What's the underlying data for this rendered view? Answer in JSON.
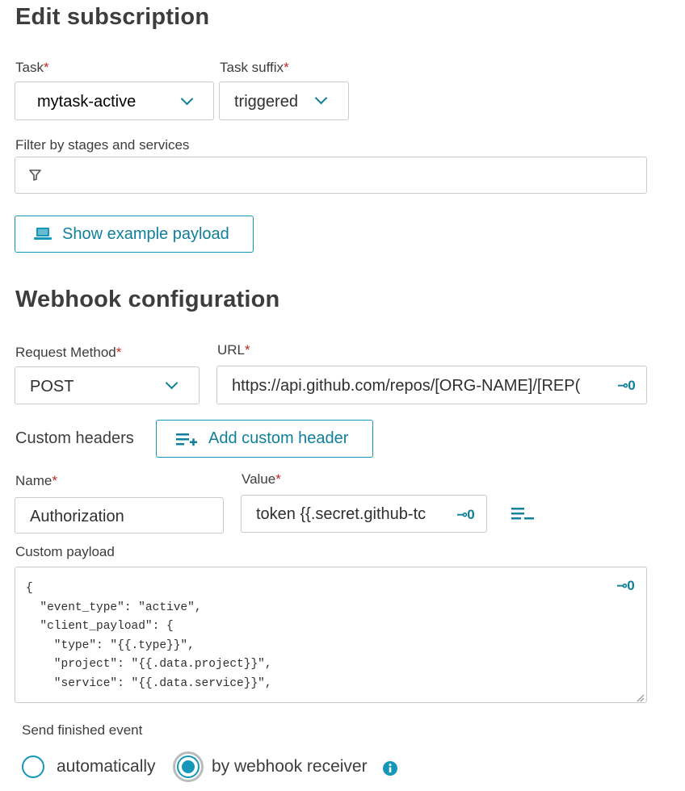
{
  "subscription": {
    "heading": "Edit subscription",
    "task_label": "Task",
    "task_value": "mytask-active",
    "suffix_label": "Task suffix",
    "suffix_value": "triggered",
    "filter_label": "Filter by stages and services",
    "filter_value": "",
    "example_button": "Show example payload"
  },
  "webhook": {
    "heading": "Webhook configuration",
    "method_label": "Request Method",
    "method_value": "POST",
    "url_label": "URL",
    "url_value": "https://api.github.com/repos/[ORG-NAME]/[REP(",
    "custom_headers_label": "Custom headers",
    "add_header_button": "Add custom header",
    "name_label": "Name",
    "name_value": "Authorization",
    "value_label": "Value",
    "value_value": "token {{.secret.github-tc",
    "payload_label": "Custom payload",
    "payload_text": "{\n  \"event_type\": \"active\",\n  \"client_payload\": {\n    \"type\": \"{{.type}}\",\n    \"project\": \"{{.data.project}}\",\n    \"service\": \"{{.data.service}}\","
  },
  "finished": {
    "label": "Send finished event",
    "option_auto": "automatically",
    "option_receiver": "by webhook receiver",
    "selected": "by webhook receiver"
  },
  "required_marker": "*",
  "icons": {
    "filter": "filter-icon",
    "laptop": "laptop-icon",
    "add_list": "add-list-icon",
    "remove_list": "remove-list-icon",
    "key": "key-icon",
    "info": "info-icon",
    "chevron": "chevron-down-icon"
  },
  "colors": {
    "accent": "#1497b8",
    "accent_dark": "#0f7f9b",
    "required": "#c4281f",
    "border": "#c9cbcc"
  }
}
